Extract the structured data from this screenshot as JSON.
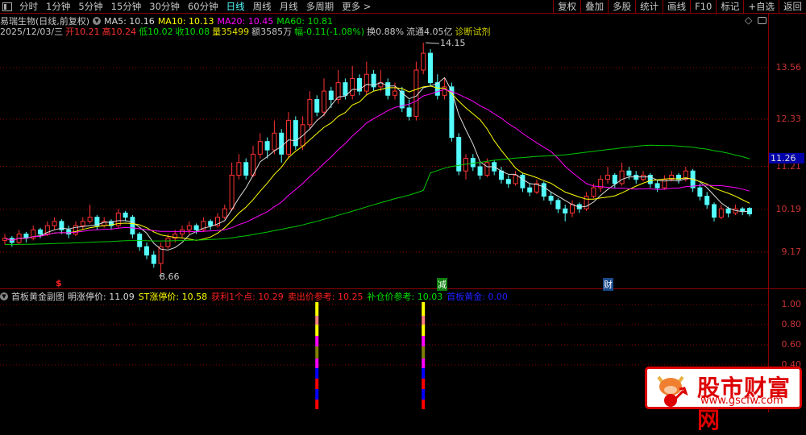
{
  "toolbar": {
    "tabs": [
      "分时",
      "1分钟",
      "5分钟",
      "15分钟",
      "30分钟",
      "60分钟",
      "日线",
      "周线",
      "月线",
      "多周期",
      "更多 >"
    ],
    "active": "日线",
    "right_buttons": [
      "复权",
      "叠加",
      "多股",
      "统计",
      "画线",
      "F10",
      "标记",
      "+自选",
      "返回"
    ]
  },
  "header": {
    "stock": "易瑞生物(日线,前复权)",
    "ma5": "MA5: 10.16",
    "ma10": "MA10: 10.13",
    "ma20": "MA20: 10.45",
    "ma60": "MA60: 10.81",
    "date": "2025/12/03/三",
    "open": "开10.21",
    "high": "高10.24",
    "low": "低10.02",
    "close": "收10.08",
    "vol": "量35499",
    "amount": "额3585万",
    "change": "幅-0.11(-1.08%)",
    "turnover": "换0.88%",
    "float": "流通4.05亿",
    "diag": "诊断试剂"
  },
  "colors": {
    "up": "#ff3232",
    "down": "#54fcfc",
    "ma5": "#dcdcdc",
    "ma10": "#ffff00",
    "ma20": "#ff00ff",
    "ma60": "#00c800",
    "grid": "#8b0000",
    "axis_text": "#c83232"
  },
  "main_axis": {
    "ticks": [
      "13.56",
      "12.33",
      "11.21",
      "10.19",
      "9.17"
    ],
    "current": "11.26"
  },
  "annotations": {
    "high": "14.15",
    "low": "8.66",
    "mark_dollar": "$",
    "mark_jian": "减",
    "mark_cai": "财"
  },
  "sub": {
    "title": "首板黄金副图",
    "items": [
      {
        "label": "明涨停价: 11.09",
        "color": "#dcdcdc"
      },
      {
        "label": "ST涨停价: 10.58",
        "color": "#ffff00"
      },
      {
        "label": "获利1个点: 10.29",
        "color": "#ff2020"
      },
      {
        "label": "卖出价参考: 10.25",
        "color": "#ff2020"
      },
      {
        "label": "补仓价参考: 10.03",
        "color": "#00e000"
      },
      {
        "label": "首板黄金: 0.00",
        "color": "#2020ff"
      }
    ],
    "ticks": [
      "1.00",
      "0.80",
      "0.60",
      "0.40"
    ],
    "bar_colors": [
      "#ffff00",
      "#ff8080",
      "#ffff00",
      "#ff00ff",
      "#808000",
      "#ff00ff",
      "#0000ff",
      "#ff0000",
      "#0000ff",
      "#ff0000"
    ],
    "bar_candles": [
      44,
      59
    ]
  },
  "logo": {
    "name": "股市财富网",
    "url": "www.gscfw.com"
  },
  "chart_data": {
    "type": "candlestick",
    "ylim": [
      8.5,
      14.4
    ],
    "yticks": [
      13.56,
      12.33,
      11.21,
      10.19,
      9.17
    ],
    "grid": true,
    "ohlc": [
      [
        9.45,
        9.6,
        9.35,
        9.5
      ],
      [
        9.5,
        9.55,
        9.3,
        9.4
      ],
      [
        9.4,
        9.7,
        9.35,
        9.6
      ],
      [
        9.6,
        9.65,
        9.4,
        9.5
      ],
      [
        9.5,
        9.8,
        9.45,
        9.7
      ],
      [
        9.7,
        9.75,
        9.5,
        9.6
      ],
      [
        9.6,
        9.9,
        9.55,
        9.8
      ],
      [
        9.8,
        10.0,
        9.7,
        9.9
      ],
      [
        9.9,
        9.95,
        9.6,
        9.7
      ],
      [
        9.7,
        9.8,
        9.5,
        9.6
      ],
      [
        9.6,
        9.9,
        9.55,
        9.8
      ],
      [
        9.8,
        10.0,
        9.7,
        9.9
      ],
      [
        9.9,
        10.3,
        9.85,
        10.0
      ],
      [
        10.0,
        10.05,
        9.7,
        9.8
      ],
      [
        9.8,
        10.0,
        9.75,
        9.9
      ],
      [
        9.9,
        9.95,
        9.7,
        9.8
      ],
      [
        9.8,
        10.2,
        9.75,
        10.1
      ],
      [
        10.1,
        10.15,
        9.9,
        10.0
      ],
      [
        10.0,
        10.05,
        9.5,
        9.6
      ],
      [
        9.6,
        9.65,
        9.2,
        9.3
      ],
      [
        9.3,
        9.4,
        9.0,
        9.1
      ],
      [
        9.1,
        9.2,
        8.8,
        8.9
      ],
      [
        8.9,
        9.4,
        8.66,
        9.3
      ],
      [
        9.3,
        9.6,
        9.25,
        9.5
      ],
      [
        9.5,
        9.7,
        9.4,
        9.6
      ],
      [
        9.6,
        9.8,
        9.5,
        9.7
      ],
      [
        9.7,
        9.9,
        9.6,
        9.8
      ],
      [
        9.8,
        9.85,
        9.6,
        9.7
      ],
      [
        9.7,
        10.0,
        9.65,
        9.9
      ],
      [
        9.9,
        9.95,
        9.7,
        9.8
      ],
      [
        9.8,
        10.1,
        9.75,
        10.0
      ],
      [
        10.0,
        10.3,
        9.95,
        10.2
      ],
      [
        10.2,
        11.3,
        10.15,
        11.0
      ],
      [
        11.0,
        11.5,
        10.9,
        11.3
      ],
      [
        11.3,
        11.4,
        10.9,
        11.0
      ],
      [
        11.0,
        11.7,
        10.95,
        11.5
      ],
      [
        11.5,
        12.0,
        11.4,
        11.8
      ],
      [
        11.8,
        11.9,
        11.4,
        11.6
      ],
      [
        11.6,
        12.3,
        11.5,
        12.0
      ],
      [
        12.0,
        12.1,
        11.3,
        11.5
      ],
      [
        11.5,
        12.5,
        11.4,
        12.3
      ],
      [
        12.3,
        12.4,
        11.6,
        11.7
      ],
      [
        11.7,
        12.4,
        11.6,
        12.2
      ],
      [
        12.2,
        13.0,
        12.1,
        12.8
      ],
      [
        12.8,
        12.9,
        12.4,
        12.5
      ],
      [
        12.5,
        13.3,
        12.4,
        13.0
      ],
      [
        13.0,
        13.1,
        12.6,
        12.8
      ],
      [
        12.8,
        13.5,
        12.7,
        13.2
      ],
      [
        13.2,
        13.3,
        12.8,
        12.9
      ],
      [
        12.9,
        13.6,
        12.8,
        13.3
      ],
      [
        13.3,
        13.4,
        12.9,
        13.0
      ],
      [
        13.0,
        13.7,
        12.9,
        13.4
      ],
      [
        13.4,
        13.5,
        13.0,
        13.1
      ],
      [
        13.1,
        13.5,
        13.0,
        13.2
      ],
      [
        13.2,
        13.3,
        12.8,
        12.9
      ],
      [
        12.9,
        13.2,
        12.8,
        13.0
      ],
      [
        13.0,
        13.1,
        12.5,
        12.6
      ],
      [
        12.6,
        12.8,
        12.3,
        12.4
      ],
      [
        12.4,
        13.7,
        12.3,
        13.5
      ],
      [
        13.5,
        14.15,
        13.4,
        13.9
      ],
      [
        13.9,
        14.0,
        13.1,
        13.2
      ],
      [
        13.2,
        13.4,
        12.8,
        12.9
      ],
      [
        12.9,
        13.3,
        12.8,
        13.1
      ],
      [
        13.1,
        13.2,
        11.8,
        11.9
      ],
      [
        11.9,
        12.0,
        11.0,
        11.1
      ],
      [
        11.1,
        11.5,
        10.9,
        11.4
      ],
      [
        11.4,
        11.5,
        11.1,
        11.2
      ],
      [
        11.2,
        11.3,
        10.9,
        11.0
      ],
      [
        11.0,
        11.4,
        10.95,
        11.3
      ],
      [
        11.3,
        11.35,
        11.0,
        11.1
      ],
      [
        11.1,
        11.2,
        10.8,
        10.9
      ],
      [
        10.9,
        11.0,
        10.7,
        10.8
      ],
      [
        10.8,
        11.1,
        10.75,
        11.0
      ],
      [
        11.0,
        11.05,
        10.6,
        10.7
      ],
      [
        10.7,
        10.8,
        10.5,
        10.6
      ],
      [
        10.6,
        10.9,
        10.55,
        10.8
      ],
      [
        10.8,
        10.85,
        10.4,
        10.5
      ],
      [
        10.5,
        10.6,
        10.3,
        10.4
      ],
      [
        10.4,
        10.45,
        10.1,
        10.2
      ],
      [
        10.2,
        10.3,
        9.9,
        10.1
      ],
      [
        10.1,
        10.4,
        10.0,
        10.3
      ],
      [
        10.3,
        10.35,
        10.1,
        10.2
      ],
      [
        10.2,
        10.6,
        10.15,
        10.5
      ],
      [
        10.5,
        10.8,
        10.45,
        10.7
      ],
      [
        10.7,
        11.0,
        10.6,
        10.9
      ],
      [
        10.9,
        11.2,
        10.8,
        11.0
      ],
      [
        11.0,
        11.05,
        10.7,
        10.8
      ],
      [
        10.8,
        11.3,
        10.75,
        11.1
      ],
      [
        11.1,
        11.2,
        10.9,
        11.0
      ],
      [
        11.0,
        11.1,
        10.8,
        10.9
      ],
      [
        10.9,
        11.1,
        10.85,
        11.0
      ],
      [
        11.0,
        11.05,
        10.7,
        10.8
      ],
      [
        10.8,
        10.9,
        10.6,
        10.7
      ],
      [
        10.7,
        11.0,
        10.65,
        10.9
      ],
      [
        10.9,
        11.1,
        10.85,
        11.0
      ],
      [
        11.0,
        11.05,
        10.8,
        10.9
      ],
      [
        10.9,
        11.2,
        10.85,
        11.1
      ],
      [
        11.1,
        11.15,
        10.6,
        10.7
      ],
      [
        10.7,
        10.8,
        10.4,
        10.5
      ],
      [
        10.5,
        10.6,
        10.2,
        10.3
      ],
      [
        10.3,
        10.35,
        9.9,
        10.0
      ],
      [
        10.0,
        10.3,
        9.95,
        10.2
      ],
      [
        10.2,
        10.25,
        10.0,
        10.1
      ],
      [
        10.1,
        10.3,
        10.05,
        10.2
      ],
      [
        10.2,
        10.24,
        10.05,
        10.15
      ],
      [
        10.21,
        10.24,
        10.02,
        10.08
      ]
    ],
    "ma_periods": [
      5,
      10,
      20,
      60
    ]
  }
}
